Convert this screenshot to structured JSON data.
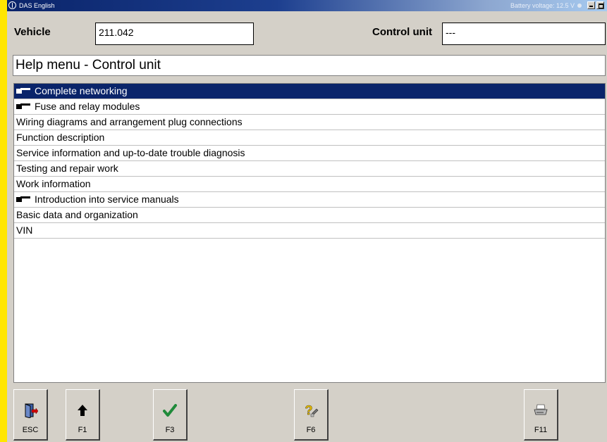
{
  "titlebar": {
    "title": "DAS English",
    "battery": "Battery voltage: 12.5 V"
  },
  "header": {
    "vehicle_label": "Vehicle",
    "vehicle_value": "211.042",
    "control_unit_label": "Control unit",
    "control_unit_value": "---"
  },
  "heading": "Help menu - Control unit",
  "menu_items": [
    {
      "label": "Complete networking",
      "icon": "pointing-hand-icon",
      "selected": true
    },
    {
      "label": "Fuse and relay modules",
      "icon": "pointing-hand-icon"
    },
    {
      "label": "Wiring diagrams and arrangement plug connections"
    },
    {
      "label": "Function description"
    },
    {
      "label": "Service information and up-to-date trouble diagnosis"
    },
    {
      "label": "Testing and repair work"
    },
    {
      "label": "Work information"
    },
    {
      "label": "Introduction into service manuals",
      "icon": "pointing-hand-icon"
    },
    {
      "label": "Basic data and organization"
    },
    {
      "label": "VIN"
    }
  ],
  "buttons": [
    {
      "key": "ESC",
      "icon": "exit-door-icon"
    },
    {
      "key": "F1",
      "icon": "arrow-up-icon"
    },
    {
      "key": "F3",
      "icon": "checkmark-icon"
    },
    {
      "key": "F6",
      "icon": "help-question-icon"
    },
    {
      "key": "F11",
      "icon": "printer-icon"
    }
  ],
  "colors": {
    "selection": "#0a246a",
    "background": "#d4d0c8",
    "frame": "#ffe600"
  }
}
